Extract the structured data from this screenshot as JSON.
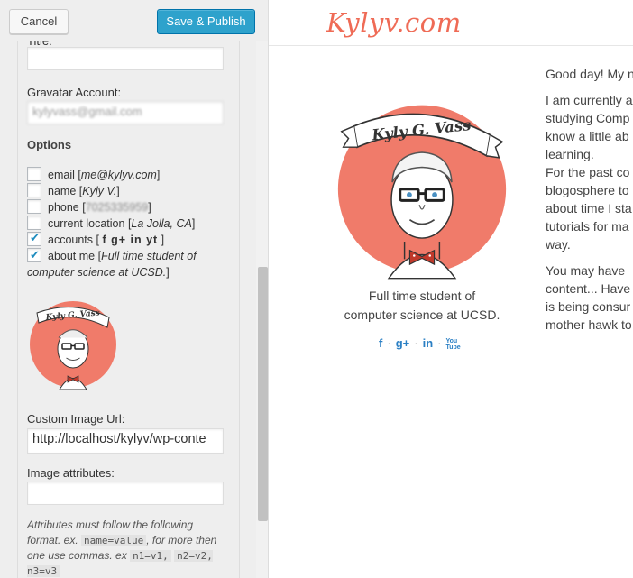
{
  "toolbar": {
    "cancel_label": "Cancel",
    "publish_label": "Save & Publish"
  },
  "form": {
    "title_label": "Title:",
    "title_value": "",
    "gravatar_label": "Gravatar Account:",
    "gravatar_value": "kylyvass@gmail.com",
    "options_heading": "Options",
    "options": [
      {
        "label": "email",
        "detail": "me@kylyv.com",
        "checked": false
      },
      {
        "label": "name",
        "detail": "Kyly V.",
        "checked": false
      },
      {
        "label": "phone",
        "detail": "7025335959",
        "checked": false
      },
      {
        "label": "current location",
        "detail": "La Jolla, CA",
        "checked": false
      },
      {
        "label": "accounts",
        "detail": "f g+ in yt",
        "checked": true
      },
      {
        "label": "about me",
        "detail": "Full time student of computer science at UCSD.",
        "checked": true
      }
    ],
    "custom_image_label": "Custom Image Url:",
    "custom_image_value": "http://localhost/kylyv/wp-conte",
    "image_attrs_label": "Image attributes:",
    "image_attrs_value": "",
    "note_text": "Attributes must follow the following format. ex.",
    "note_code1": "name=value",
    "note_text2": ", for more then one use commas. ex",
    "note_code2": "n1=v1, n2=v2, n3=v3",
    "note_code2_a": "n1=v1,",
    "note_code2_b": "n2=v2, n3=v3"
  },
  "avatar": {
    "banner_text": "Kyly G. Vass"
  },
  "preview": {
    "site_title": "Kylyv.com",
    "bio_line1": "Full time student of",
    "bio_line2": "computer science at UCSD.",
    "social": {
      "facebook": "f",
      "googleplus": "g+",
      "linkedin": "in",
      "youtube": "You Tube"
    },
    "article_p1": [
      "Good day! My n"
    ],
    "article_p2": [
      "I am currently a",
      "studying Comp",
      "know a little ab",
      "learning.",
      "For the past co",
      "blogosphere to",
      "about time I sta",
      "tutorials for ma",
      "way."
    ],
    "article_p3": [
      "You may have",
      "content... Have",
      "is being consur",
      "mother hawk to"
    ]
  },
  "colors": {
    "accent": "#ef6b56",
    "avatar_bg": "#f07b6a",
    "publish": "#2ea2cc",
    "social": "#2a7fc4",
    "check": "#1e8cbe"
  }
}
